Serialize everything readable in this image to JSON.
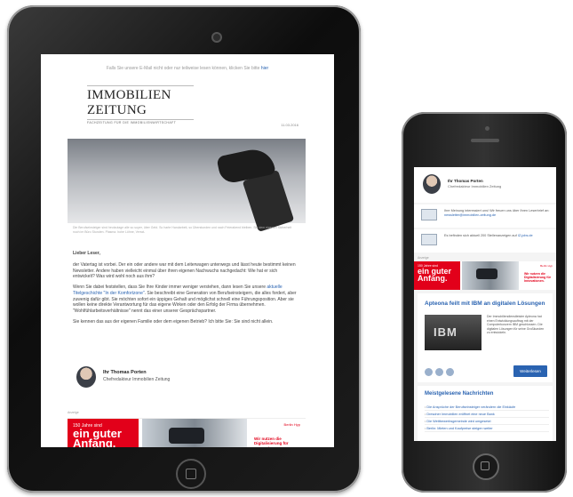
{
  "tablet": {
    "preheader": "Falls Sie unsere E-Mail nicht oder nur teilweise lesen können, klicken Sie bitte",
    "preheader_link": "hier",
    "logo": "IMMOBILIEN ZEITUNG",
    "logo_sub": "FACHZEITUNG FÜR DIE IMMOBILIENWIRTSCHAFT",
    "date": "11.03.2016",
    "caption": "Die Berufseinsteiger sind heutzutage alle so super, über Geld. So harte Handarbeit, so Überstunden und nach Feierabend bleiben. Sie dem eigenen Sicherheit noch im Büro Stunden. Plasma. hohe Löhne, Verrat-",
    "greeting": "Lieber Leser,",
    "p1": "der Vatertag ist vorbei. Der ein oder andere war mit dem Leiterwagen unterwegs und lässt heute bestimmt keinen Newsletter. Andere haben vielleicht einmal über ihren eigenen Nachwuchs nachgedacht: Wie hat er sich entwickelt? Was wird wohl noch aus ihm?",
    "p2_a": "Wenn Sie dabei feststellen, dass Sie Ihre Kinder immer weniger verstehen, dann lesen Sie unsere",
    "p2_link": "aktuelle Titelgeschichte \"In der Komfortzone\"",
    "p2_b": ". Sie beschreibt eine Generation von Berufseinsteigern, die alles fordert, aber zuwenig dafür gibt. Sie möchten sofort ein üppiges Gehalt und möglichst schnell eine Führungsposition. Aber sie wollen keine direkte Verantwortung für das eigene Wirken oder den Erfolg der Firma übernehmen. \"Wohlfühlarbeitsverhältnisse\" nennt das einer unserer Gesprächspartner.",
    "p3": "Sie kennen das aus der eigenen Familie oder dem eigenen Betrieb? Ich bitte Sie: Sie sind nicht allein.",
    "sig_name": "Ihr Thomas Porten",
    "sig_role": "Chefredakteur Immobilien Zeitung",
    "ad_label": "Anzeige",
    "banner_l1": "150 Jahre sind",
    "banner_l2": "ein guter",
    "banner_l3": "Anfang.",
    "banner_brand": "Berlin Hyp",
    "banner_right": "Wir nutzen die Digitalisierung für Innovationen."
  },
  "phone": {
    "sig_name": "Ihr Thomas Porten",
    "sig_role": "Chefredakteur Immobilien Zeitung",
    "row1": "Ihre Meinung interessiert uns! Wir freuen uns über Ihren Leserbrief an:",
    "row1_link": "newsletter@immobilien-zeitung.de",
    "row2": "Es befinden sich aktuell 200 Stellenanzeigen auf",
    "row2_link": "IZ-jobs.de",
    "ad_label": "Anzeige",
    "banner_l1": "150 Jahre sind",
    "banner_l2": "ein guter",
    "banner_l3": "Anfang.",
    "banner_brand": "Berlin Hyp",
    "banner_right": "Wir nutzen die Digitalisierung für Innovationen.",
    "article_title": "Apteona feilt mit IBM an digitalen Lösungen",
    "article_img": "IBM",
    "article_text": "Der Immobiliendienstleister Apleona hat einen Entwicklungsauftrag mit der Computerkonzern IBM geschlossen. Die digitalen Lösungen für seine Großkunden zu entwickeln.",
    "read_more": "Weiterlesen",
    "list_title": "Meistgelesene Nachrichten",
    "list": [
      "Die Ansprüche der Berufseinsteiger verändern die Einkäufe",
      "Dresdner Immobilien eröffnet eine neue Bank",
      "Die Wettbewerbsgemeinde wird umgesetzt",
      "Berlin: Mieten und Kaufpreise steigen weiter"
    ]
  }
}
